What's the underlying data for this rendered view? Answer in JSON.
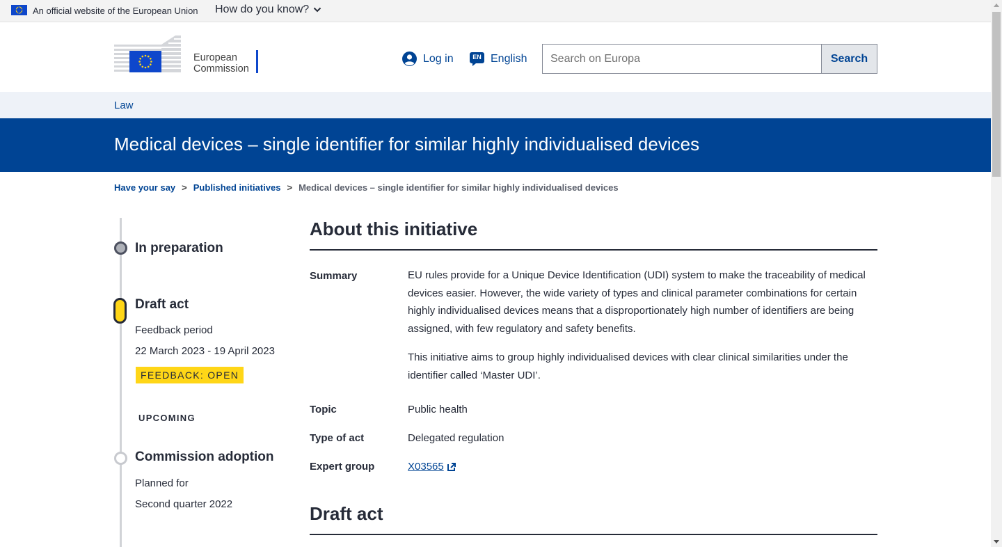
{
  "eu_bar": {
    "official_text": "An official website of the European Union",
    "how_know": "How do you know?"
  },
  "header": {
    "logo_line1": "European",
    "logo_line2": "Commission",
    "login": "Log in",
    "lang_code": "EN",
    "language": "English",
    "search_placeholder": "Search on Europa",
    "search_button": "Search"
  },
  "site": {
    "section": "Law",
    "page_title": "Medical devices – single identifier for similar highly individualised devices"
  },
  "breadcrumb": {
    "items": [
      "Have your say",
      "Published initiatives"
    ],
    "current": "Medical devices – single identifier for similar highly individualised devices"
  },
  "timeline": {
    "stage1": "In preparation",
    "stage2": "Draft act",
    "stage2_period_label": "Feedback period",
    "stage2_dates": "22 March 2023 - 19 April 2023",
    "stage2_badge": "FEEDBACK: OPEN",
    "upcoming_label": "UPCOMING",
    "stage3": "Commission adoption",
    "stage3_planned_label": "Planned for",
    "stage3_date": "Second quarter 2022"
  },
  "about": {
    "heading": "About this initiative",
    "summary_label": "Summary",
    "summary_p1": "EU rules provide for a Unique Device Identification (UDI) system to make the traceability of medical devices easier. However, the wide variety of types and clinical parameter combinations for certain highly individualised devices means that a disproportionately high number of identifiers are being assigned, with few regulatory and safety benefits.",
    "summary_p2": "This initiative aims to group highly individualised devices with clear clinical similarities under the identifier called ‘Master UDI’.",
    "topic_label": "Topic",
    "topic": "Public health",
    "type_label": "Type of act",
    "type": "Delegated regulation",
    "expert_label": "Expert group",
    "expert": "X03565"
  },
  "draft": {
    "heading": "Draft act"
  },
  "colors": {
    "eu_blue": "#004494",
    "yellow": "#ffd617",
    "text": "#262b38"
  }
}
